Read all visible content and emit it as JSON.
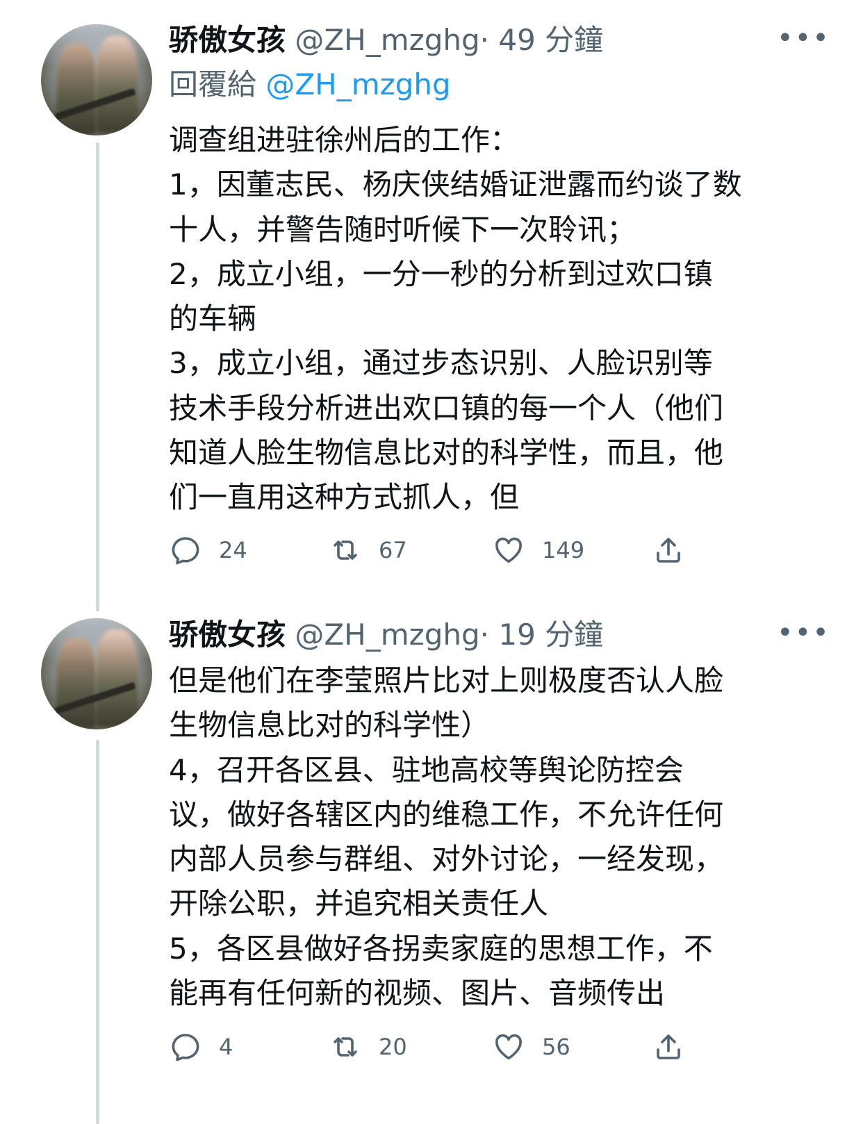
{
  "tweets": [
    {
      "name": "骄傲女孩",
      "handle": "@ZH_mzghg",
      "separator": "·",
      "time": "49 分鐘",
      "more": "•••",
      "reply_to_label": "回覆給",
      "reply_to_handle": "@ZH_mzghg",
      "lines": [
        "调查组进驻徐州后的工作：",
        "1，因董志民、杨庆侠结婚证泄露而约谈了数",
        "十人，并警告随时听候下一次聆讯；",
        "2，成立小组，一分一秒的分析到过欢口镇",
        "的车辆",
        "3，成立小组，通过步态识别、人脸识别等",
        "技术手段分析进出欢口镇的每一个人（他们",
        "知道人脸生物信息比对的科学性，而且，他",
        "们一直用这种方式抓人，但"
      ],
      "replies": "24",
      "retweets": "67",
      "likes": "149"
    },
    {
      "name": "骄傲女孩",
      "handle": "@ZH_mzghg",
      "separator": "·",
      "time": "19 分鐘",
      "more": "•••",
      "lines": [
        "但是他们在李莹照片比对上则极度否认人脸",
        "生物信息比对的科学性）",
        "4，召开各区县、驻地高校等舆论防控会",
        "议，做好各辖区内的维稳工作，不允许任何",
        "内部人员参与群组、对外讨论，一经发现，",
        "开除公职，并追究相关责任人",
        "5，各区县做好各拐卖家庭的思想工作，不",
        "能再有任何新的视频、图片、音频传出"
      ],
      "replies": "4",
      "retweets": "20",
      "likes": "56"
    }
  ],
  "colors": {
    "text": "#0f1419",
    "secondary": "#536471",
    "link": "#1d9bf0",
    "thread_line": "#cfd9de"
  },
  "icons": [
    "reply-icon",
    "retweet-icon",
    "like-icon",
    "share-icon",
    "more-icon"
  ]
}
